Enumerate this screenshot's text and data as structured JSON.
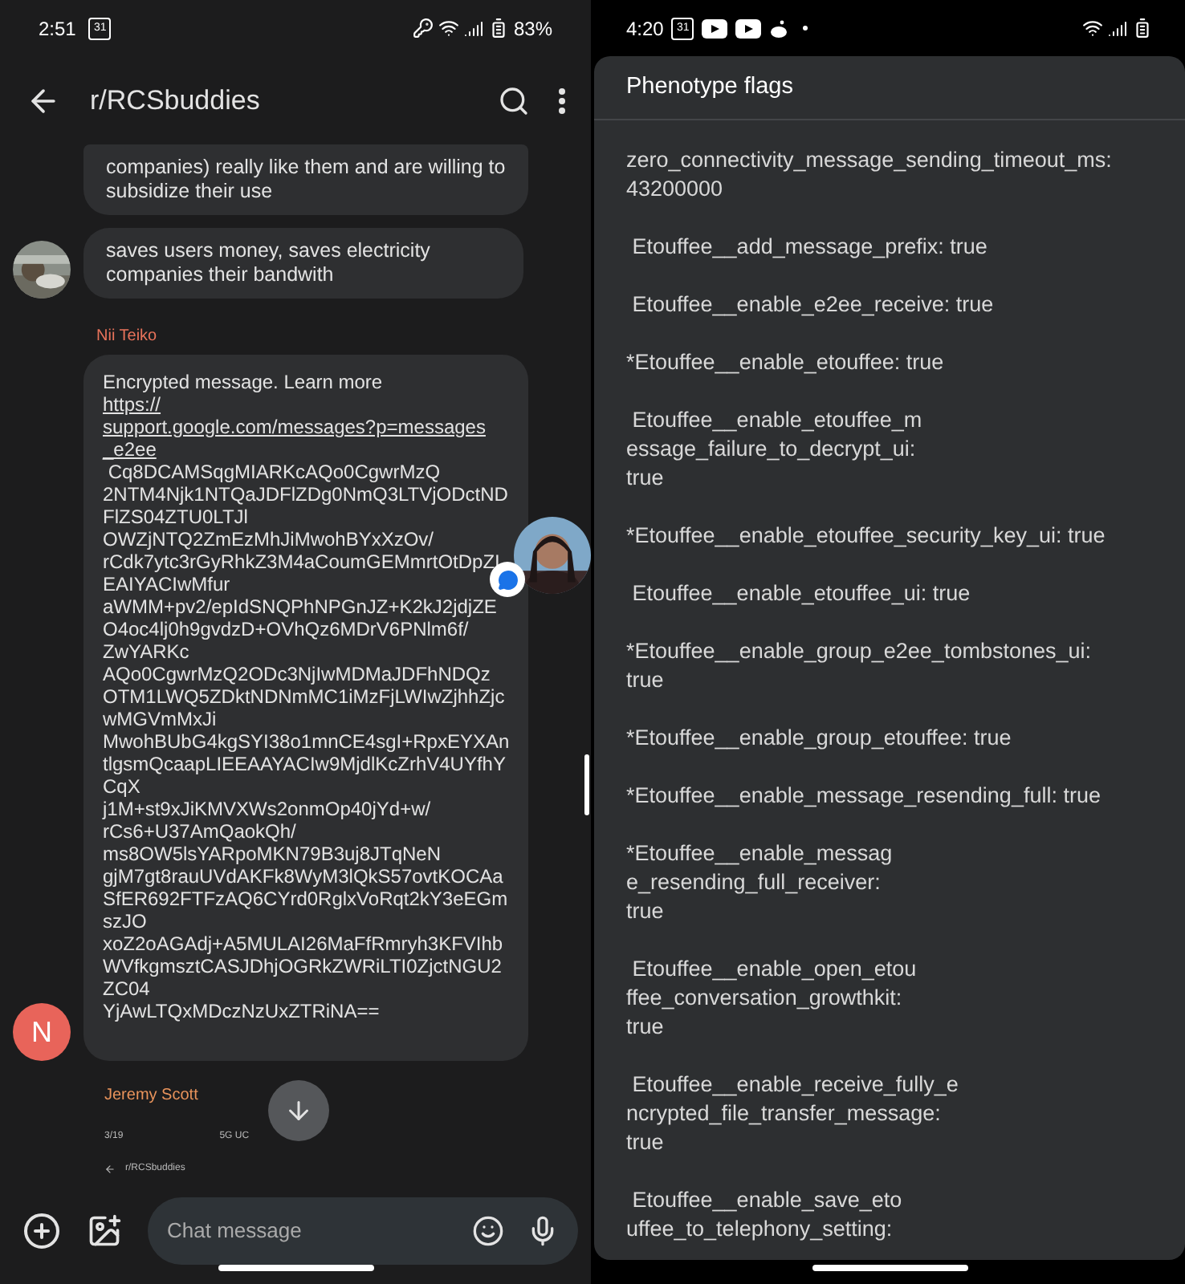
{
  "left_screen": {
    "status_bar": {
      "time": "2:51",
      "calendar_day": "31",
      "battery": "83%"
    },
    "header": {
      "title": "r/RCSbuddies"
    },
    "messages": [
      {
        "kind": "continued",
        "text": "companies) really like them and are willing to\nsubsidize their use"
      },
      {
        "kind": "with_avatar",
        "text": "saves users money, saves electricity\ncompanies their bandwith"
      }
    ],
    "encrypted_message": {
      "sender": "Nii Teiko",
      "intro": "Encrypted message. Learn more ",
      "link": "https://\nsupport.google.com/messages?p=messages\n_e2ee",
      "body": " Cq8DCAMSqgMIARKcAQo0CgwrMzQ\n2NTM4Njk1NTQaJDFlZDg0NmQ3LTVjODctND\nFlZS04ZTU0LTJl\nOWZjNTQ2ZmEzMhJiMwohBYxXzOv/\nrCdk7ytc3rGyRhkZ3M4aCoumGEMmrtOtDpZI\nEAIYACIwMfur\naWMM+pv2/epIdSNQPhNPGnJZ+K2kJ2jdjZE\nO4oc4lj0h9gvdzD+OVhQz6MDrV6PNlm6f/\nZwYARKc\nAQo0CgwrMzQ2ODc3NjIwMDMaJDFhNDQz\nOTM1LWQ5ZDktNDNmMC1iMzFjLWIwZjhhZjc\nwMGVmMxJi\nMwohBUbG4kgSYI38o1mnCE4sgI+RpxEYXAn\ntlgsmQcaapLIEEAAYACIw9MjdlKcZrhV4UYfhY\nCqX\nj1M+st9xJiKMVXWs2onmOp40jYd+w/\nrCs6+U37AmQaokQh/\nms8OW5lsYARpoMKN79B3uj8JTqNeN\ngjM7gt8rauUVdAKFk8WyM3lQkS57ovtKOCAa\nSfER692FTFzAQ6CYrd0RglxVoRqt2kY3eEGm\nszJO\nxoZ2oAGAdj+A5MULAI26MaFfRmryh3KFVIhb\nWVfkgmsztCASJDhjOGRkZWRiLTI0ZjctNGU2\nZC04\nYjAwLTQxMDczNzUxZTRiNA==",
      "avatar_letter": "N"
    },
    "next_sender": "Jeremy Scott",
    "preview": {
      "time": "3/19",
      "network": "5G UC",
      "title": "r/RCSbuddies"
    },
    "composer": {
      "placeholder": "Chat message"
    }
  },
  "right_screen": {
    "status_bar": {
      "time": "4:20",
      "calendar_day": "31"
    },
    "dialog": {
      "title": "Phenotype flags",
      "flags": [
        "zero_connectivity_message_sending_timeout_ms:\n43200000",
        " Etouffee__add_message_prefix: true",
        " Etouffee__enable_e2ee_receive: true",
        "*Etouffee__enable_etouffee: true",
        " Etouffee__enable_etouffee_m\nessage_failure_to_decrypt_ui:\ntrue",
        "*Etouffee__enable_etouffee_security_key_ui: true",
        " Etouffee__enable_etouffee_ui: true",
        "*Etouffee__enable_group_e2ee_tombstones_ui:\ntrue",
        "*Etouffee__enable_group_etouffee: true",
        "*Etouffee__enable_message_resending_full: true",
        "*Etouffee__enable_messag\ne_resending_full_receiver:\ntrue",
        " Etouffee__enable_open_etou\nffee_conversation_growthkit:\ntrue",
        " Etouffee__enable_receive_fully_e\nncrypted_file_transfer_message:\ntrue",
        " Etouffee__enable_save_eto\nuffee_to_telephony_setting:"
      ]
    }
  }
}
